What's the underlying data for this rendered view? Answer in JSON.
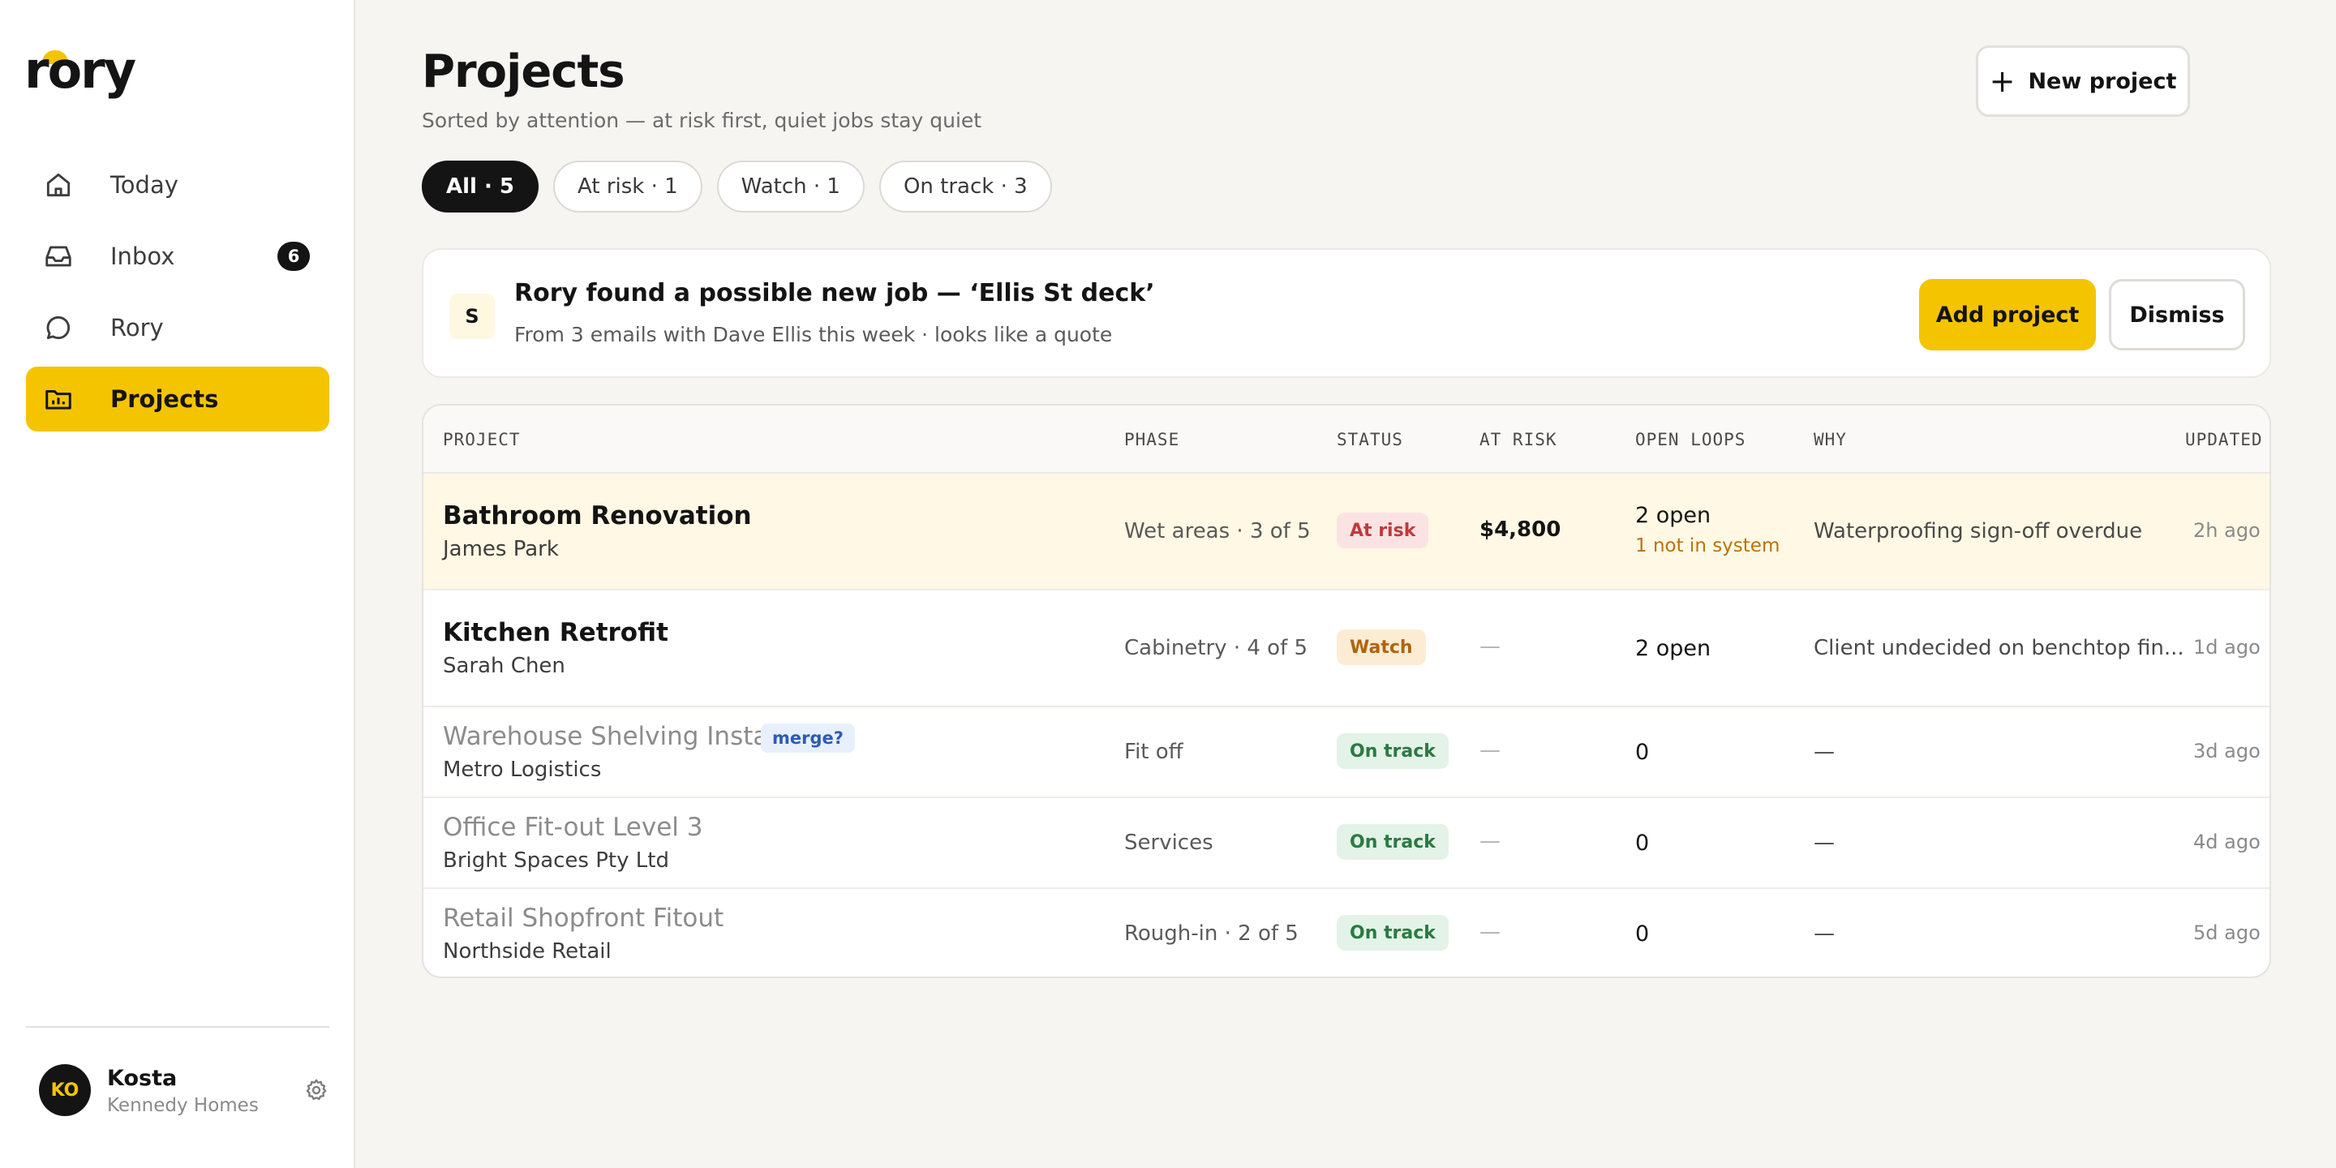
{
  "app": {
    "logo": "rory"
  },
  "sidebar": {
    "items": [
      {
        "label": "Today",
        "icon": "home-icon"
      },
      {
        "label": "Inbox",
        "icon": "inbox-icon",
        "badge": "6"
      },
      {
        "label": "Rory",
        "icon": "chat-bubble-icon"
      },
      {
        "label": "Projects",
        "icon": "folder-chart-icon",
        "active": true
      }
    ],
    "user": {
      "initials": "KO",
      "name": "Kosta",
      "org": "Kennedy Homes"
    }
  },
  "header": {
    "title": "Projects",
    "subtitle": "Sorted by attention — at risk first, quiet jobs stay quiet",
    "new_project_label": "New project"
  },
  "filters": [
    {
      "label": "All · 5",
      "active": true
    },
    {
      "label": "At risk · 1"
    },
    {
      "label": "Watch · 1"
    },
    {
      "label": "On track · 3"
    }
  ],
  "suggestion": {
    "source_initial": "S",
    "title": "Rory found a possible new job — ‘Ellis St deck’",
    "subtitle": "From 3 emails with Dave Ellis this week · looks like a quote",
    "add_label": "Add project",
    "dismiss_label": "Dismiss"
  },
  "table": {
    "columns": [
      "PROJECT",
      "PHASE",
      "STATUS",
      "AT RISK",
      "OPEN LOOPS",
      "WHY",
      "UPDATED"
    ],
    "rows": [
      {
        "name": "Bathroom Renovation",
        "client": "James Park",
        "phase": "Wet areas · 3 of 5",
        "status": "At risk",
        "at_risk": "$4,800",
        "open_loops": "2 open",
        "open_loops_note": "1 not in system",
        "why": "Waterproofing sign-off overdue",
        "updated": "2h ago"
      },
      {
        "name": "Kitchen Retrofit",
        "client": "Sarah Chen",
        "phase": "Cabinetry · 4 of 5",
        "status": "Watch",
        "at_risk": "—",
        "open_loops": "2 open",
        "why": "Client undecided on benchtop fin...",
        "updated": "1d ago"
      },
      {
        "name": "Warehouse Shelving Install",
        "tag": "merge?",
        "client": "Metro Logistics",
        "phase": "Fit off",
        "status": "On track",
        "at_risk": "—",
        "open_loops": "0",
        "why": "—",
        "updated": "3d ago"
      },
      {
        "name": "Office Fit-out Level 3",
        "client": "Bright Spaces Pty Ltd",
        "phase": "Services",
        "status": "On track",
        "at_risk": "—",
        "open_loops": "0",
        "why": "—",
        "updated": "4d ago"
      },
      {
        "name": "Retail Shopfront Fitout",
        "client": "Northside Retail",
        "phase": "Rough-in · 2 of 5",
        "status": "On track",
        "at_risk": "—",
        "open_loops": "0",
        "why": "—",
        "updated": "5d ago"
      }
    ]
  },
  "colors": {
    "accent": "#f5c400",
    "at_risk_badge": "#c03a3a",
    "watch_badge": "#b0640d",
    "on_track_badge": "#2a7a42",
    "risk_row_bg": "#fef8e4"
  }
}
